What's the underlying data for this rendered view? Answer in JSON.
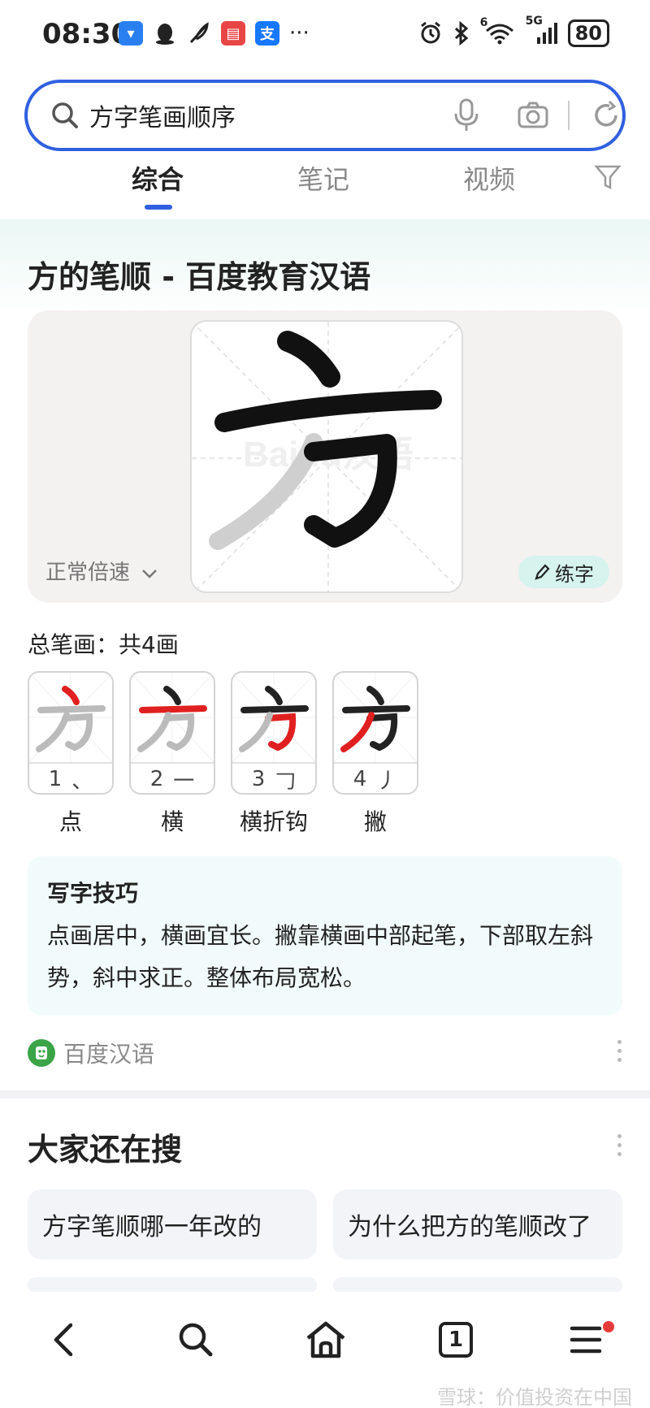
{
  "status_bar": {
    "time": "08:30",
    "battery": "80",
    "network": "5G",
    "wifi_badge": "6",
    "more": "···"
  },
  "search": {
    "query": "方字笔画顺序"
  },
  "tabs": [
    {
      "label": "综合",
      "active": true
    },
    {
      "label": "笔记",
      "active": false
    },
    {
      "label": "视频",
      "active": false
    }
  ],
  "result": {
    "title": "方的笔顺 - 百度教育汉语",
    "character": "方",
    "speed_label": "正常倍速",
    "practice_label": "练字",
    "watermark": "Baidu汉语",
    "total_strokes": "总笔画：共4画",
    "strokes": [
      {
        "num": "1",
        "glyph": "、",
        "name": "点"
      },
      {
        "num": "2",
        "glyph": "一",
        "name": "横"
      },
      {
        "num": "3",
        "glyph": "𠃌",
        "name": "横折钩"
      },
      {
        "num": "4",
        "glyph": "丿",
        "name": "撇"
      }
    ],
    "tips_title": "写字技巧",
    "tips_text": "点画居中，横画宜长。撇靠横画中部起笔，下部取左斜势，斜中求正。整体布局宽松。",
    "source": "百度汉语"
  },
  "related": {
    "title": "大家还在搜",
    "items": [
      "方字笔顺哪一年改的",
      "为什么把方的笔顺改了"
    ]
  },
  "bottom_nav": {
    "tab_count": "1"
  },
  "watermark": "雪球：价值投资在中国",
  "colors": {
    "accent": "#3060e0",
    "stroke_highlight": "#e02020",
    "practice_bg": "#d6f3ee",
    "tips_bg": "#f2fbfb"
  }
}
